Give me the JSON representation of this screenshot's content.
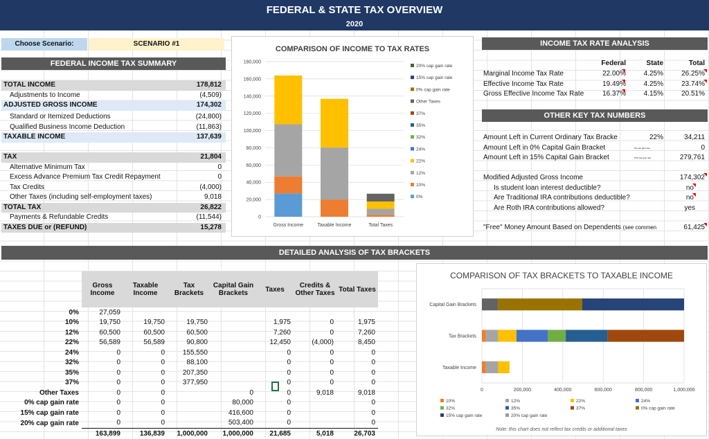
{
  "banner": {
    "title": "FEDERAL & STATE TAX OVERVIEW",
    "year": "2020"
  },
  "scenario": {
    "label": "Choose Scenario:",
    "value": "SCENARIO #1"
  },
  "federal_summary": {
    "title": "FEDERAL INCOME TAX SUMMARY",
    "rows": [
      {
        "label": "TOTAL INCOME",
        "value": "178,812"
      },
      {
        "label": "Adjustments to Income",
        "value": "(4,509)"
      },
      {
        "label": "ADJUSTED GROSS INCOME",
        "value": "174,302"
      },
      {
        "label": "Standard or Itemized Deductions",
        "value": "(24,800)"
      },
      {
        "label": "Qualified Business Income Deduction",
        "value": "(11,863)"
      },
      {
        "label": "TAXABLE INCOME",
        "value": "137,639"
      },
      {
        "label": "TAX",
        "value": "21,804"
      },
      {
        "label": "Alternative Minimum Tax",
        "value": "0"
      },
      {
        "label": "Excess Advance Premium Tax Credit Repayment",
        "value": "0"
      },
      {
        "label": "Tax Credits",
        "value": "(4,000)"
      },
      {
        "label": "Other Taxes (including self-employment taxes)",
        "value": "9,018"
      },
      {
        "label": "TOTAL TAX",
        "value": "26,822"
      },
      {
        "label": "Payments & Refundable Credits",
        "value": "(11,544)"
      },
      {
        "label": "TAXES DUE or (REFUND)",
        "value": "15,278"
      }
    ]
  },
  "rate_analysis": {
    "title": "INCOME TAX RATE ANALYSIS",
    "headers": [
      "Federal",
      "State",
      "Total"
    ],
    "rows": [
      {
        "label": "Marginal Income Tax Rate",
        "federal": "22.00%",
        "state": "4.25%",
        "total": "26.25%"
      },
      {
        "label": "Effective Income Tax Rate",
        "federal": "19.49%",
        "state": "4.25%",
        "total": "23.74%"
      },
      {
        "label": "Gross Effective Income Tax Rate",
        "federal": "16.37%",
        "state": "4.15%",
        "total": "20.51%"
      }
    ]
  },
  "key_numbers": {
    "title": "OTHER KEY TAX NUMBERS",
    "rows": [
      {
        "label": "Amount Left in Current Ordinary Tax Bracke",
        "mid": "22%",
        "value": "34,211"
      },
      {
        "label": "Amount Left in 0% Capital Gain Bracket",
        "mid": "0% cap gain rate",
        "value": "0"
      },
      {
        "label": "Amount Left in 15% Capital Gain Bracket",
        "mid": "15% cap gain rate",
        "value": "279,761"
      }
    ],
    "magi_label": "Modified Adjusted Gross Income",
    "magi_value": "174,302",
    "questions": [
      {
        "label": "Is student loan interest deductible?",
        "value": "no"
      },
      {
        "label": "Are Traditional IRA contributions deductible?",
        "value": "no"
      },
      {
        "label": "Are Roth IRA contributions allowed?",
        "value": "yes"
      }
    ],
    "free_money_label": "\"Free\" Money Amount Based on Dependents",
    "free_money_note": "(see commen",
    "free_money_value": "61,425"
  },
  "detailed": {
    "title": "DETAILED ANALYSIS OF TAX BRACKETS",
    "headers": [
      "Gross Income",
      "Taxable Income",
      "Tax Brackets",
      "Capital Gain Brackets",
      "Taxes",
      "Credits & Other Taxes",
      "Total Taxes"
    ],
    "rows": [
      {
        "label": "0%",
        "c": [
          "27,059",
          "",
          "",
          "",
          "",
          "",
          ""
        ]
      },
      {
        "label": "10%",
        "c": [
          "19,750",
          "19,750",
          "19,750",
          "",
          "1,975",
          "0",
          "1,975"
        ]
      },
      {
        "label": "12%",
        "c": [
          "60,500",
          "60,500",
          "60,500",
          "",
          "7,260",
          "0",
          "7,260"
        ]
      },
      {
        "label": "22%",
        "c": [
          "56,589",
          "56,589",
          "90,800",
          "",
          "12,450",
          "(4,000)",
          "8,450"
        ]
      },
      {
        "label": "24%",
        "c": [
          "0",
          "0",
          "155,550",
          "",
          "0",
          "0",
          "0"
        ]
      },
      {
        "label": "32%",
        "c": [
          "0",
          "0",
          "88,100",
          "",
          "0",
          "0",
          "0"
        ]
      },
      {
        "label": "35%",
        "c": [
          "0",
          "0",
          "207,350",
          "",
          "0",
          "0",
          "0"
        ]
      },
      {
        "label": "37%",
        "c": [
          "0",
          "0",
          "377,950",
          "",
          "0",
          "0",
          "0"
        ]
      },
      {
        "label": "Other Taxes",
        "c": [
          "0",
          "0",
          "",
          "0",
          "0",
          "9,018",
          "9,018"
        ]
      },
      {
        "label": "0% cap gain rate",
        "c": [
          "0",
          "0",
          "",
          "80,000",
          "0",
          "",
          "0"
        ]
      },
      {
        "label": "15% cap gain rate",
        "c": [
          "0",
          "0",
          "",
          "416,600",
          "0",
          "",
          "0"
        ]
      },
      {
        "label": "20% cap gain rate",
        "c": [
          "0",
          "0",
          "",
          "503,400",
          "0",
          "",
          "0"
        ]
      },
      {
        "label": "",
        "c": [
          "163,899",
          "136,839",
          "1,000,000",
          "1,000,000",
          "21,685",
          "5,018",
          "26,703"
        ]
      }
    ]
  },
  "chart_data": [
    {
      "type": "bar",
      "stacked": true,
      "title": "COMPARISON OF INCOME TO TAX RATES",
      "categories": [
        "Gross Income",
        "Taxable Income",
        "Total Taxes"
      ],
      "ylim": [
        0,
        180000
      ],
      "yticks": [
        "0",
        "20,000",
        "40,000",
        "60,000",
        "80,000",
        "100,000",
        "120,000",
        "140,000",
        "160,000",
        "180,000"
      ],
      "legend_position": "right",
      "series": [
        {
          "name": "0%",
          "color": "#5b9bd5",
          "values": [
            27059,
            0,
            0
          ]
        },
        {
          "name": "10%",
          "color": "#ed7d31",
          "values": [
            19750,
            19750,
            1975
          ]
        },
        {
          "name": "12%",
          "color": "#a5a5a5",
          "values": [
            60500,
            60500,
            7260
          ]
        },
        {
          "name": "22%",
          "color": "#ffc000",
          "values": [
            56589,
            56589,
            8450
          ]
        },
        {
          "name": "24%",
          "color": "#4472c4",
          "values": [
            0,
            0,
            0
          ]
        },
        {
          "name": "32%",
          "color": "#70ad47",
          "values": [
            0,
            0,
            0
          ]
        },
        {
          "name": "35%",
          "color": "#255e91",
          "values": [
            0,
            0,
            0
          ]
        },
        {
          "name": "37%",
          "color": "#9e480e",
          "values": [
            0,
            0,
            0
          ]
        },
        {
          "name": "Other Taxes",
          "color": "#636363",
          "values": [
            0,
            0,
            9018
          ]
        },
        {
          "name": "0% cap gain rate",
          "color": "#997300",
          "values": [
            0,
            0,
            0
          ]
        },
        {
          "name": "15% cap gain rate",
          "color": "#264478",
          "values": [
            0,
            0,
            0
          ]
        },
        {
          "name": "20% cap gain rate",
          "color": "#43682b",
          "values": [
            0,
            0,
            0
          ]
        }
      ]
    },
    {
      "type": "bar",
      "orientation": "horizontal",
      "stacked": true,
      "title": "COMPARISON OF TAX BRACKETS TO TAXABLE INCOME",
      "categories": [
        "Capital Gain Brackets",
        "Tax Brackets",
        "Taxable Income"
      ],
      "xlim": [
        0,
        1000000
      ],
      "xticks": [
        "0",
        "200,000",
        "400,000",
        "600,000",
        "800,000",
        "1,000,000"
      ],
      "legend_position": "bottom",
      "note": "Note: this chart does not reflect tax credits or additional taxes",
      "legend": [
        "10%",
        "12%",
        "22%",
        "24%",
        "32%",
        "35%",
        "37%",
        "0% cap gain rate",
        "15% cap gain rate",
        "20% cap gain rate"
      ],
      "series": [
        {
          "name": "10%",
          "color": "#ed7d31",
          "values": [
            0,
            19750,
            19750
          ]
        },
        {
          "name": "12%",
          "color": "#a5a5a5",
          "values": [
            0,
            60500,
            60500
          ]
        },
        {
          "name": "22%",
          "color": "#ffc000",
          "values": [
            0,
            90800,
            56589
          ]
        },
        {
          "name": "24%",
          "color": "#4472c4",
          "values": [
            0,
            155550,
            0
          ]
        },
        {
          "name": "32%",
          "color": "#70ad47",
          "values": [
            0,
            88100,
            0
          ]
        },
        {
          "name": "35%",
          "color": "#255e91",
          "values": [
            0,
            207350,
            0
          ]
        },
        {
          "name": "37%",
          "color": "#9e480e",
          "values": [
            0,
            377950,
            0
          ]
        },
        {
          "name": "Other Taxes",
          "color": "#636363",
          "values": [
            80000,
            0,
            0
          ]
        },
        {
          "name": "0% cap gain rate",
          "color": "#997300",
          "values": [
            416600,
            0,
            0
          ]
        },
        {
          "name": "15% cap gain rate",
          "color": "#264478",
          "values": [
            503400,
            0,
            0
          ]
        }
      ]
    }
  ]
}
